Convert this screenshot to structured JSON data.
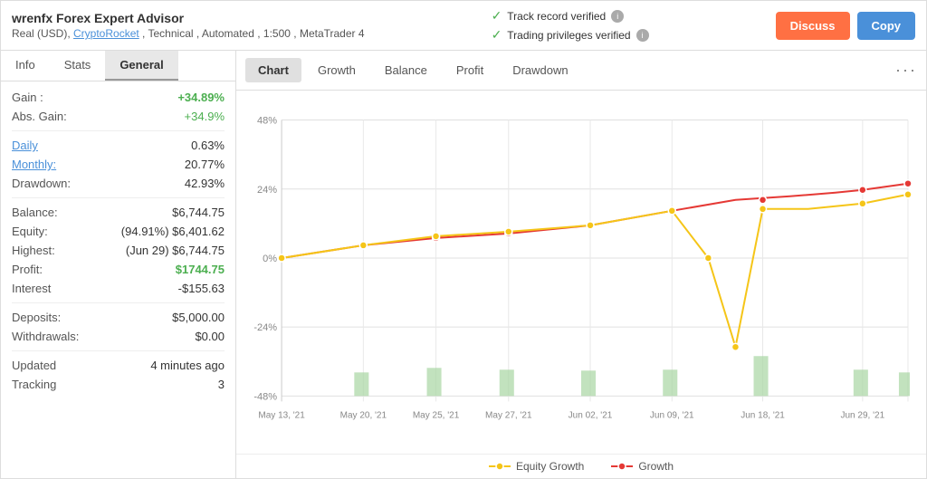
{
  "header": {
    "title": "wrenfx Forex Expert Advisor",
    "subtitle_text": "Real (USD), ",
    "subtitle_link": "CryptoRocket",
    "subtitle_rest": " , Technical , Automated , 1:500 , MetaTrader 4",
    "verify1": "Track record verified",
    "verify2": "Trading privileges verified",
    "btn_discuss": "Discuss",
    "btn_copy": "Copy"
  },
  "left_panel": {
    "tabs": [
      "Info",
      "Stats",
      "General"
    ],
    "active_tab": "General",
    "stats": {
      "gain_label": "Gain :",
      "gain_value": "+34.89%",
      "abs_gain_label": "Abs. Gain:",
      "abs_gain_value": "+34.9%",
      "daily_label": "Daily",
      "daily_value": "0.63%",
      "monthly_label": "Monthly:",
      "monthly_value": "20.77%",
      "drawdown_label": "Drawdown:",
      "drawdown_value": "42.93%",
      "balance_label": "Balance:",
      "balance_value": "$6,744.75",
      "equity_label": "Equity:",
      "equity_value": "(94.91%) $6,401.62",
      "highest_label": "Highest:",
      "highest_value": "(Jun 29) $6,744.75",
      "profit_label": "Profit:",
      "profit_value": "$1744.75",
      "interest_label": "Interest",
      "interest_value": "-$155.63",
      "deposits_label": "Deposits:",
      "deposits_value": "$5,000.00",
      "withdrawals_label": "Withdrawals:",
      "withdrawals_value": "$0.00",
      "updated_label": "Updated",
      "updated_value": "4 minutes ago",
      "tracking_label": "Tracking",
      "tracking_value": "3"
    }
  },
  "chart": {
    "tabs": [
      "Chart",
      "Growth",
      "Balance",
      "Profit",
      "Drawdown"
    ],
    "active_tab": "Chart",
    "legend": {
      "equity_label": "Equity Growth",
      "growth_label": "Growth"
    },
    "y_labels": [
      "48%",
      "24%",
      "0%",
      "-24%",
      "-48%"
    ],
    "x_labels": [
      "May 13, '21",
      "May 20, '21",
      "May 25, '21",
      "May 27, '21",
      "Jun 02, '21",
      "Jun 09, '21",
      "Jun 18, '21",
      "Jun 29, '21"
    ]
  }
}
